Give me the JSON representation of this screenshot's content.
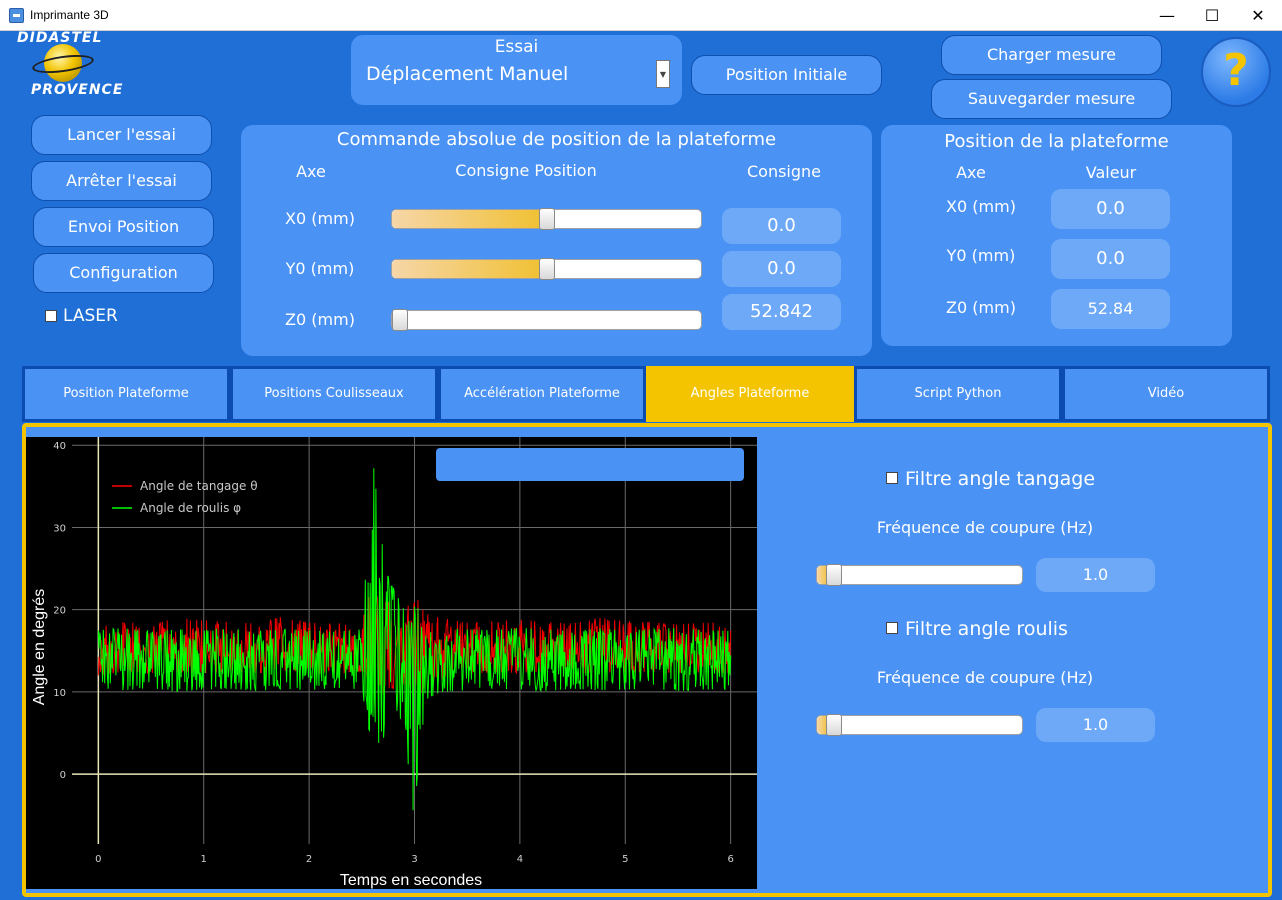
{
  "window": {
    "title": "Imprimante 3D",
    "minimize": "—",
    "maximize": "☐",
    "close": "✕"
  },
  "logo": {
    "top": "DIDASTEL",
    "bottom": "PROVENCE"
  },
  "essai": {
    "title": "Essai",
    "selected": "Déplacement Manuel",
    "arrow": "▼"
  },
  "buttons": {
    "position_initiale": "Position Initiale",
    "charger": "Charger mesure",
    "sauvegarder": "Sauvegarder mesure",
    "help": "?",
    "lancer": "Lancer l'essai",
    "arreter": "Arrêter l'essai",
    "envoi": "Envoi Position",
    "configuration": "Configuration"
  },
  "laser": {
    "label": "LASER",
    "checked": false
  },
  "commande": {
    "title": "Commande absolue de position de la plateforme",
    "col_axe": "Axe",
    "col_consigne_position": "Consigne Position",
    "col_consigne": "Consigne",
    "rows": [
      {
        "label": "X0 (mm)",
        "value": "0.0",
        "slider_fraction": 0.5
      },
      {
        "label": "Y0 (mm)",
        "value": "0.0",
        "slider_fraction": 0.5
      },
      {
        "label": "Z0 (mm)",
        "value": "52.842",
        "slider_fraction": 0.0
      }
    ]
  },
  "position": {
    "title": "Position de la plateforme",
    "col_axe": "Axe",
    "col_valeur": "Valeur",
    "rows": [
      {
        "label": "X0 (mm)",
        "value": "0.0"
      },
      {
        "label": "Y0 (mm)",
        "value": "0.0"
      },
      {
        "label": "Z0 (mm)",
        "value": "52.84"
      }
    ]
  },
  "tabs": [
    {
      "label": "Position Plateforme",
      "active": false
    },
    {
      "label": "Positions Coulisseaux",
      "active": false
    },
    {
      "label": "Accélération Plateforme",
      "active": false
    },
    {
      "label": "Angles Plateforme",
      "active": true
    },
    {
      "label": "Script Python",
      "active": false
    },
    {
      "label": "Vidéo",
      "active": false
    }
  ],
  "filters": {
    "tangage": {
      "label": "Filtre angle tangage",
      "checked": false,
      "freq_label": "Fréquence de coupure (Hz)",
      "value": "1.0",
      "slider_fraction": 0.05
    },
    "roulis": {
      "label": "Filtre angle roulis",
      "checked": false,
      "freq_label": "Fréquence de coupure (Hz)",
      "value": "1.0",
      "slider_fraction": 0.05
    }
  },
  "colors": {
    "accent": "#f5c400",
    "background": "#1f6fd6",
    "panel": "#4a92f4",
    "tangage": "#ff0000",
    "roulis": "#00ff00"
  },
  "chart_data": {
    "type": "line",
    "title": "",
    "xlabel": "Temps en secondes",
    "ylabel": "Angle en degrés",
    "xlim": [
      -0.25,
      6.25
    ],
    "ylim": [
      -8.5,
      41
    ],
    "xticks": [
      0,
      1,
      2,
      3,
      4,
      5,
      6
    ],
    "yticks": [
      0,
      10,
      20,
      30,
      40
    ],
    "grid": true,
    "legend_position": "top-left",
    "series": [
      {
        "name": "Angle de tangage θ",
        "color": "#ff0000",
        "x": [
          0,
          0.25,
          0.5,
          0.75,
          1,
          1.25,
          1.5,
          1.75,
          2,
          2.25,
          2.5,
          2.6,
          2.75,
          2.9,
          3.0,
          3.1,
          3.25,
          3.5,
          3.75,
          4,
          4.25,
          4.5,
          4.75,
          5,
          5.25,
          5.5,
          5.75,
          6
        ],
        "values": [
          15,
          15.3,
          15.1,
          15.2,
          15,
          15.4,
          15.1,
          15.3,
          15.2,
          15.1,
          15.3,
          16,
          15.5,
          15,
          16,
          15.5,
          15.3,
          15.4,
          15.2,
          15.5,
          15.3,
          15.1,
          15.4,
          15.2,
          15.3,
          15.1,
          15.2,
          15
        ],
        "min": [
          12,
          12.5,
          12.3,
          12.4,
          12.2,
          12.5,
          12.3,
          12.6,
          12.4,
          12.3,
          12.5,
          9,
          10,
          11,
          7,
          10,
          11.5,
          12.2,
          12.4,
          12.3,
          12.5,
          12.2,
          12.4,
          12.3,
          12.5,
          12.2,
          12.4,
          12.3
        ],
        "max": [
          18,
          18.5,
          18.2,
          19,
          18.7,
          18.5,
          18.3,
          19.2,
          18.4,
          18.3,
          18.5,
          23,
          21,
          19.5,
          22,
          19.5,
          19,
          18.4,
          18.6,
          18.8,
          18.5,
          18.3,
          19,
          18.6,
          18.5,
          18.2,
          18.4,
          18.5
        ]
      },
      {
        "name": "Angle de roulis φ",
        "color": "#00ff00",
        "x": [
          0,
          0.25,
          0.5,
          0.75,
          1,
          1.25,
          1.5,
          1.75,
          2,
          2.25,
          2.5,
          2.6,
          2.75,
          2.9,
          3.0,
          3.1,
          3.25,
          3.5,
          3.75,
          4,
          4.25,
          4.5,
          4.75,
          5,
          5.25,
          5.5,
          5.75,
          6
        ],
        "values": [
          14,
          13.8,
          14,
          13.9,
          14,
          13.7,
          13.9,
          14,
          13.8,
          14,
          13.9,
          15,
          14.5,
          13,
          14,
          13.5,
          13.8,
          14,
          13.9,
          13.8,
          14,
          13.9,
          14,
          13.8,
          14,
          13.9,
          13.8,
          14
        ],
        "min": [
          10.5,
          10.2,
          10.5,
          10,
          10.3,
          10.4,
          10.1,
          10.4,
          10.2,
          10.5,
          10.3,
          3,
          5,
          6,
          -6,
          9,
          10,
          10.2,
          10.4,
          10.3,
          10.1,
          10.4,
          10.2,
          10.3,
          10.4,
          10.1,
          10.3,
          10.2
        ],
        "max": [
          17.5,
          17.8,
          17.3,
          17.6,
          17.5,
          17.9,
          17.4,
          17.6,
          17.5,
          17.3,
          17.6,
          38.5,
          24,
          20,
          21,
          18.5,
          17.8,
          17.6,
          17.5,
          17.8,
          17.6,
          17.4,
          17.7,
          17.5,
          17.6,
          17.8,
          17.5,
          17.4
        ]
      }
    ]
  }
}
